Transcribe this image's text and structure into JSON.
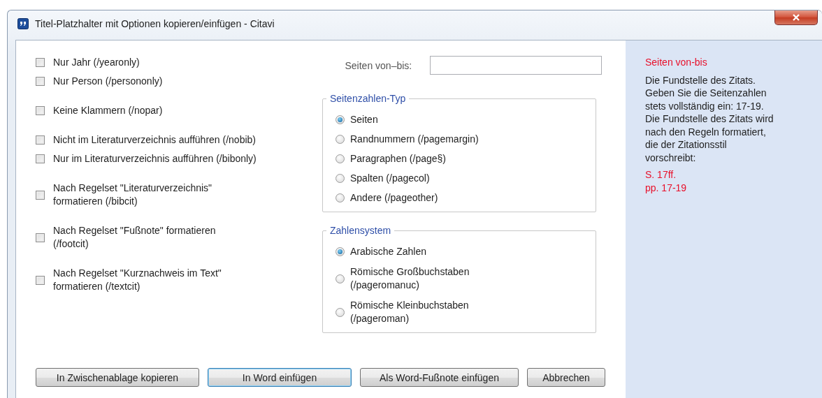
{
  "window": {
    "title": "Titel-Platzhalter mit Optionen kopieren/einfügen - Citavi"
  },
  "option_groups": [
    [
      {
        "label": "Nur Jahr (/yearonly)",
        "checked": false
      },
      {
        "label": "Nur Person (/persononly)",
        "checked": false
      }
    ],
    [
      {
        "label": "Keine Klammern (/nopar)",
        "checked": false
      }
    ],
    [
      {
        "label": "Nicht im Literaturverzeichnis aufführen (/nobib)",
        "checked": false
      },
      {
        "label": "Nur im Literaturverzeichnis aufführen (/bibonly)",
        "checked": false
      }
    ],
    [
      {
        "label": "Nach Regelset \"Literaturverzeichnis\"\nformatieren (/bibcit)",
        "checked": false
      }
    ],
    [
      {
        "label": "Nach Regelset \"Fußnote\" formatieren\n(/footcit)",
        "checked": false
      }
    ],
    [
      {
        "label": "Nach Regelset \"Kurznachweis im Text\"\nformatieren (/textcit)",
        "checked": false
      }
    ]
  ],
  "pages_field": {
    "label": "Seiten von–bis:"
  },
  "page_number_type": {
    "legend": "Seitenzahlen-Typ",
    "options": [
      {
        "label": "Seiten",
        "selected": true
      },
      {
        "label": "Randnummern (/pagemargin)",
        "selected": false
      },
      {
        "label": "Paragraphen (/page§)",
        "selected": false
      },
      {
        "label": "Spalten (/pagecol)",
        "selected": false
      },
      {
        "label": "Andere (/pageother)",
        "selected": false
      }
    ]
  },
  "number_system": {
    "legend": "Zahlensystem",
    "options": [
      {
        "label": "Arabische Zahlen",
        "selected": true
      },
      {
        "label": "Römische Großbuchstaben\n(/pageromanuc)",
        "selected": false
      },
      {
        "label": "Römische Kleinbuchstaben\n(/pageroman)",
        "selected": false
      }
    ]
  },
  "help": {
    "title": "Seiten von-bis",
    "text": "Die Fundstelle des Zitats.\nGeben Sie die Seitenzahlen\nstets vollständig ein: 17-19.\nDie Fundstelle des Zitats wird\nnach den Regeln formatiert,\ndie der Zitationsstil\nvorschreibt:",
    "examples": [
      "S. 17ff.",
      "pp. 17-19"
    ]
  },
  "buttons": [
    {
      "label": "In Zwischenablage kopieren",
      "default": false
    },
    {
      "label": "In Word einfügen",
      "default": true
    },
    {
      "label": "Als Word-Fußnote einfügen",
      "default": false
    },
    {
      "label": "Abbrechen",
      "default": false
    }
  ]
}
